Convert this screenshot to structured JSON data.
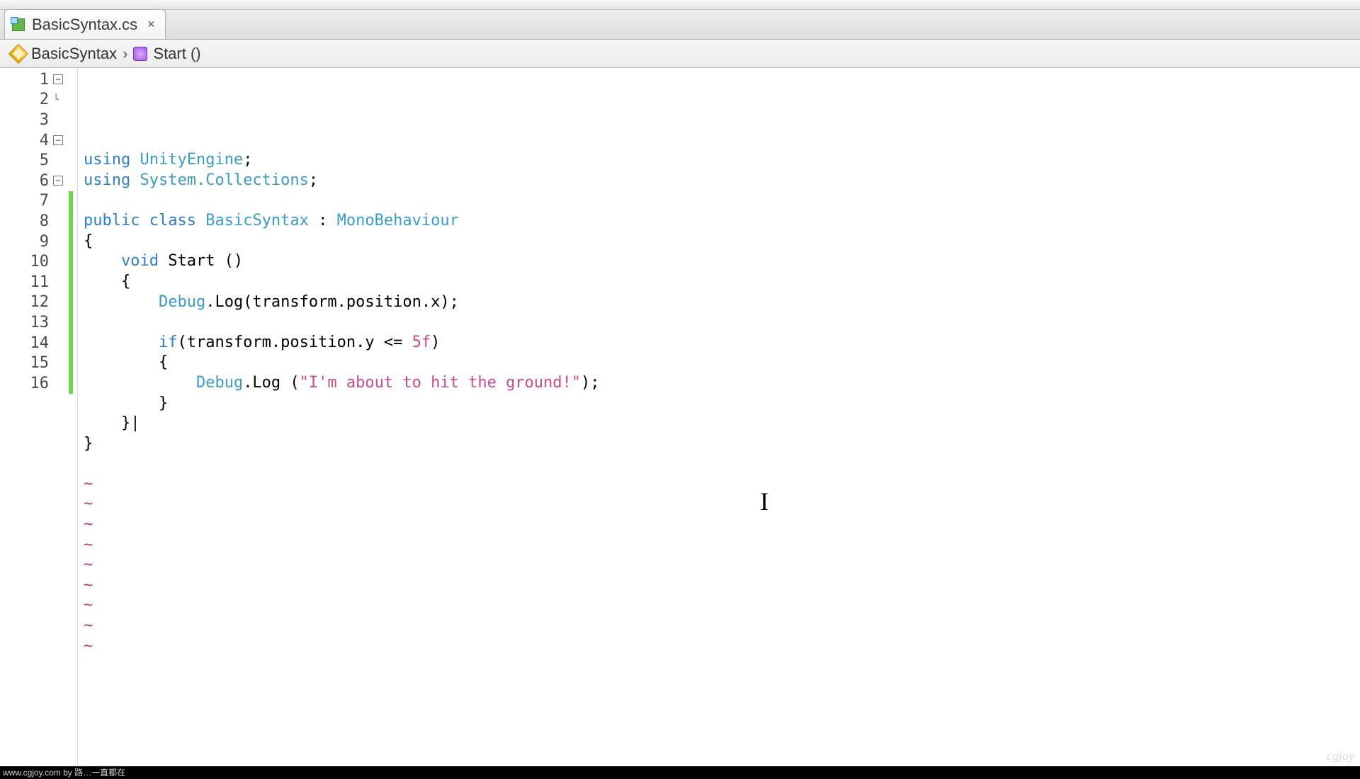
{
  "tab": {
    "filename": "BasicSyntax.cs"
  },
  "breadcrumb": {
    "class": "BasicSyntax",
    "method": "Start ()"
  },
  "gutter": {
    "lines": [
      1,
      2,
      3,
      4,
      5,
      6,
      7,
      8,
      9,
      10,
      11,
      12,
      13,
      14,
      15,
      16
    ],
    "fold_at": [
      1,
      4,
      6
    ],
    "fold_end_at": [
      2
    ],
    "changed_from": 7,
    "changed_to": 16
  },
  "code": {
    "l1": {
      "kw": "using",
      "type": "UnityEngine",
      "tail": ";"
    },
    "l2": {
      "kw": "using",
      "type": "System.Collections",
      "tail": ";"
    },
    "l3": "",
    "l4": {
      "kw1": "public",
      "kw2": "class",
      "name": "BasicSyntax",
      "colon": " : ",
      "base": "MonoBehaviour"
    },
    "l5": "{",
    "l6": {
      "indent": "    ",
      "kw": "void",
      "name": " Start ()"
    },
    "l7": "    {",
    "l8": {
      "indent": "        ",
      "type": "Debug",
      "call": ".Log(transform.position.x);"
    },
    "l9": "",
    "l10": {
      "indent": "        ",
      "kw": "if",
      "cond": "(transform.position.y <= ",
      "num": "5f",
      "tail": ")"
    },
    "l11": "        {",
    "l12": {
      "indent": "            ",
      "type": "Debug",
      "call1": ".Log (",
      "str": "\"I'm about to hit the ground!\"",
      "call2": ");"
    },
    "l13": "        }",
    "l14": "    }|",
    "l15": "}",
    "l16": ""
  },
  "tilde": "~",
  "footer": "www.cgjoy.com by 路…一直都在",
  "watermark": "cgjoy"
}
